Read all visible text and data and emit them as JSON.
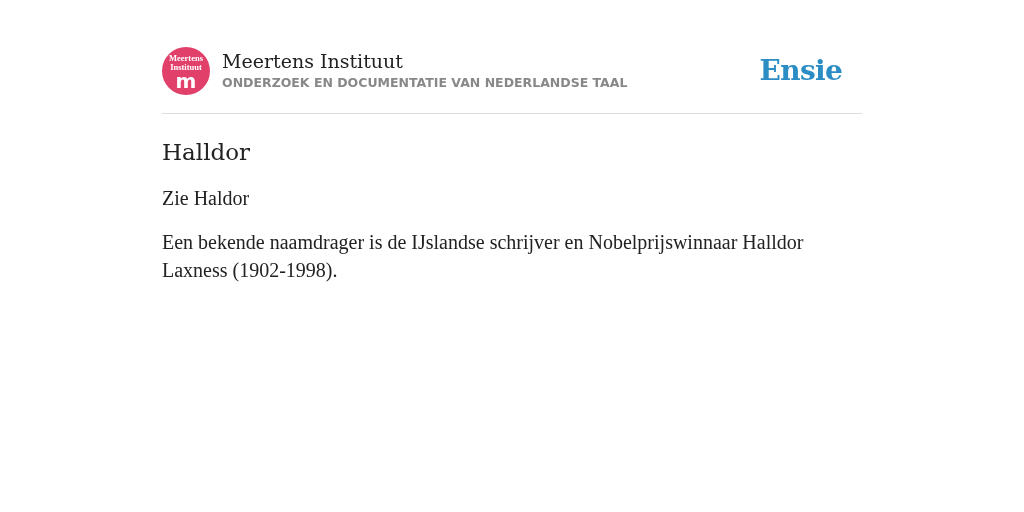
{
  "header": {
    "logo": {
      "caption": "Meertens Instituut",
      "letter": "m"
    },
    "title": "Meertens Instituut",
    "subtitle": "ONDERZOEK EN DOCUMENTATIE VAN NEDERLANDSE TAAL",
    "brand": "Ensie"
  },
  "entry": {
    "title": "Halldor",
    "paragraphs": [
      "Zie Haldor",
      "Een bekende naamdrager is de IJslandse schrijver en Nobelprijswinnaar Halldor Laxness (1902-1998)."
    ]
  }
}
